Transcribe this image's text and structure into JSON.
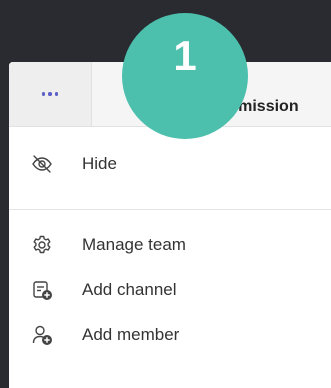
{
  "topbar": {
    "more_button_label": "More options",
    "tab_label": "ermission"
  },
  "step_badge": {
    "number": "1",
    "color": "#4cc0ad"
  },
  "menu": {
    "items": [
      {
        "label": "Hide",
        "icon": "eye-slash-icon"
      },
      {
        "label": "Manage team",
        "icon": "gear-icon"
      },
      {
        "label": "Add channel",
        "icon": "add-channel-icon"
      },
      {
        "label": "Add member",
        "icon": "add-person-icon"
      }
    ]
  },
  "colors": {
    "accent": "#5b5fc7",
    "background": "#2a2a31"
  }
}
